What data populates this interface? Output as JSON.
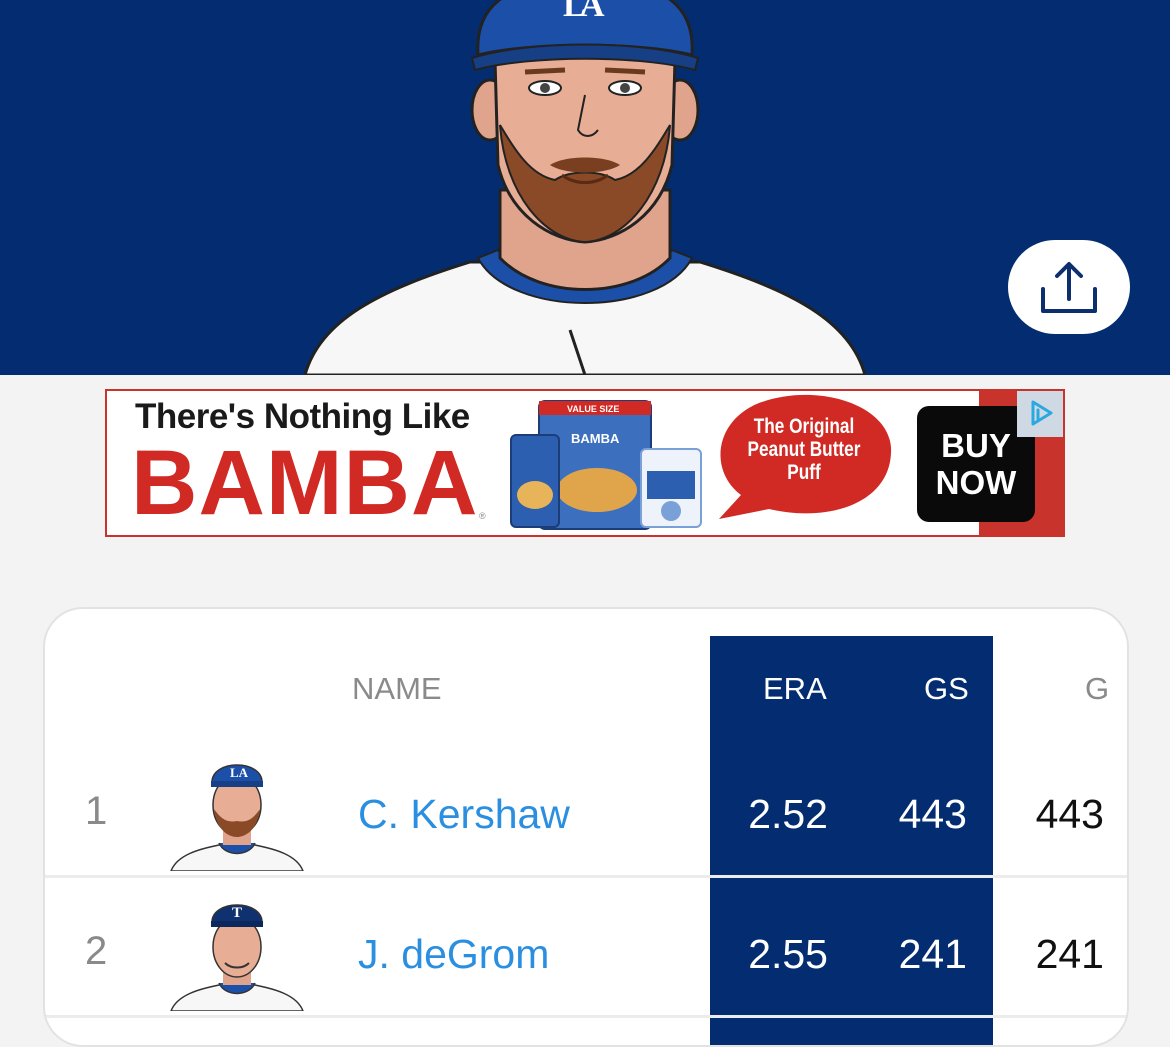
{
  "hero": {
    "background_color": "#032d70",
    "portrait_icon": "player-portrait",
    "share_icon": "share-upload-icon"
  },
  "ad": {
    "line1": "There's Nothing Like",
    "brand": "BAMBA",
    "tm": "®",
    "bag_label": "VALUE SIZE",
    "bag_brand": "BAMBA",
    "bubble_text": [
      "The Original",
      "Peanut Butter",
      "Puff"
    ],
    "cta": [
      "BUY",
      "NOW"
    ],
    "adchoices_icon": "adchoices-icon"
  },
  "table": {
    "headers": {
      "name": "NAME",
      "era": "ERA",
      "gs": "GS",
      "g": "G"
    },
    "highlight_color": "#032d70",
    "rows": [
      {
        "rank": "1",
        "name": "C. Kershaw",
        "era": "2.52",
        "gs": "443",
        "g": "443",
        "team": "LA"
      },
      {
        "rank": "2",
        "name": "J. deGrom",
        "era": "2.55",
        "gs": "241",
        "g": "241",
        "team": "T"
      }
    ]
  }
}
